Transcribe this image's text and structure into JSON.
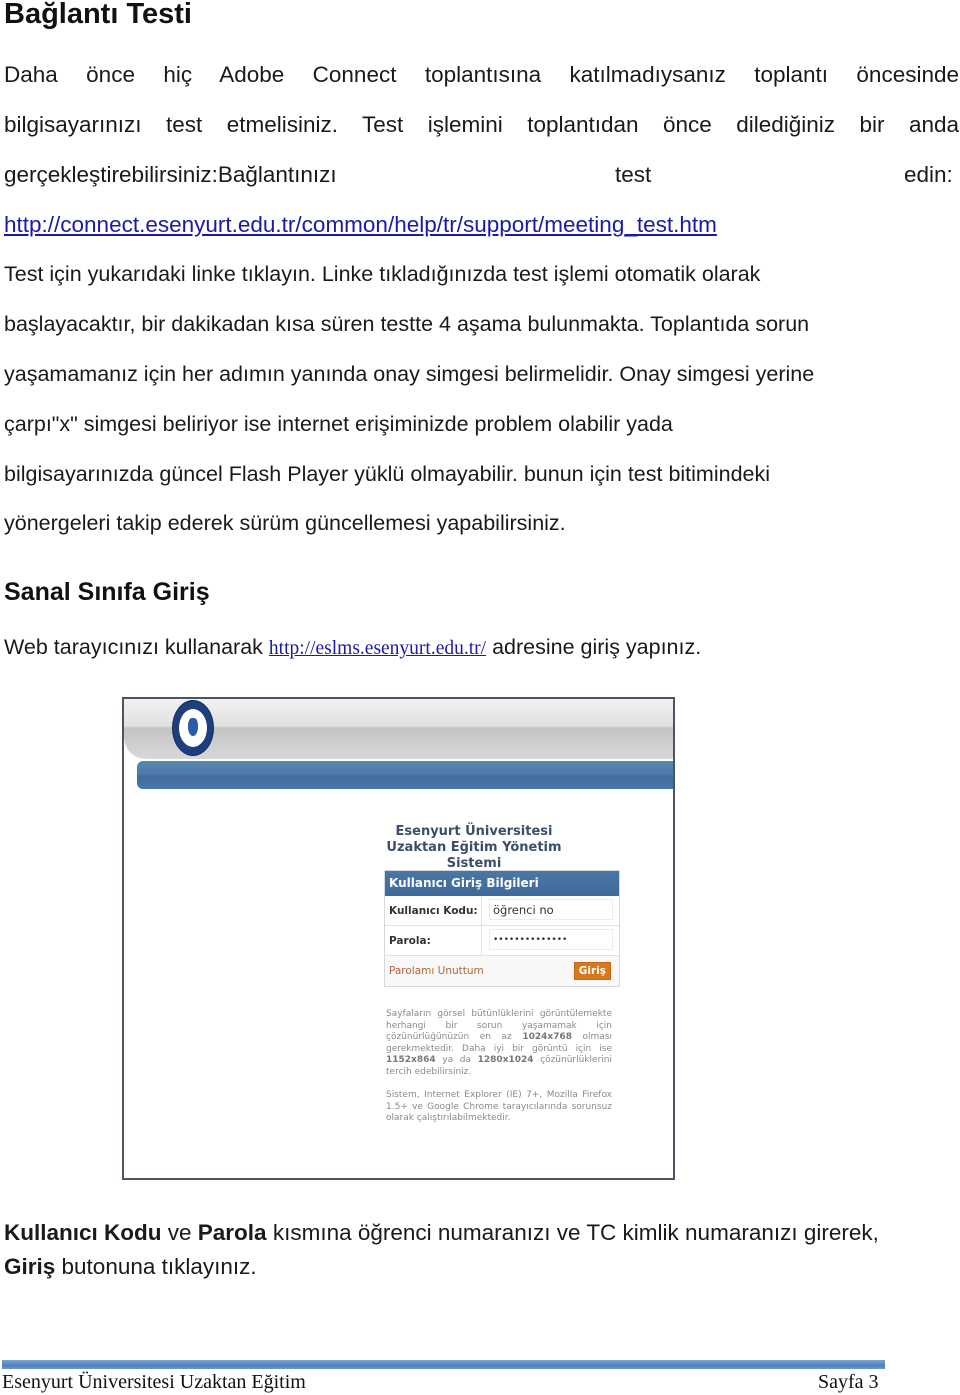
{
  "section1": {
    "title": "Bağlantı Testi",
    "para_lines": [
      "Daha önce hiç Adobe Connect toplantısına katılmadıysanız toplantı öncesinde",
      "bilgisayarınızı test etmelisiniz. Test işlemini toplantıdan önce dilediğiniz bir anda",
      "gerçekleştirebilirsiniz:Bağlantınızı test edin:"
    ],
    "line3_parts": [
      "gerçekleştirebilirsiniz:Bağlantınızı",
      "test",
      "edin:"
    ],
    "test_link": "http://connect.esenyurt.edu.tr/common/help/tr/support/meeting_test.htm",
    "body_lines": [
      "Test için yukarıdaki linke tıklayın. Linke tıkladığınızda test işlemi otomatik olarak",
      "başlayacaktır,  bir dakikadan kısa süren testte 4 aşama bulunmakta. Toplantıda sorun",
      "yaşamamanız için her adımın yanında onay simgesi belirmelidir. Onay simgesi yerine",
      "çarpı\"x\" simgesi beliriyor ise internet erişiminizde problem olabilir yada",
      "bilgisayarınızda güncel Flash Player yüklü olmayabilir. bunun için test bitimindeki",
      "yönergeleri takip ederek sürüm  güncellemesi yapabilirsiniz."
    ]
  },
  "section2": {
    "title": "Sanal Sınıfa Giriş",
    "intro_prefix": "Web tarayıcınızı kullanarak",
    "intro_link": "http://eslms.esenyurt.edu.tr/",
    "intro_suffix": "adresine giriş yapınız."
  },
  "screenshot": {
    "system_title_line1": "Esenyurt Üniversitesi",
    "system_title_line2": "Uzaktan Eğitim Yönetim Sistemi",
    "login_header": "Kullanıcı Giriş Bilgileri",
    "username_label": "Kullanıcı Kodu:",
    "username_value": "öğrenci no",
    "password_label": "Parola:",
    "password_value": "••••••••••••••",
    "forgot_link": "Parolamı Unuttum",
    "login_button": "Giriş",
    "info_p1_a": "Sayfaların görsel bütünlüklerini görüntülemekte herhangi bir sorun yaşamamak için çözünürlüğünüzün en az",
    "info_res1": "1024x768",
    "info_p1_b": "olması gerekmektedir. Daha iyi bir görüntü için ise",
    "info_res2": "1152x864",
    "info_p1_c": "ya da",
    "info_res3": "1280x1024",
    "info_p1_d": "çözünürlüklerini tercih edebilirsiniz.",
    "info_p2": "Sistem, Internet Explorer (IE) 7+, Mozilla Firefox 1.5+ ve Google Chrome tarayıcılarında sorunsuz olarak çalıştırılabilmektedir."
  },
  "note": {
    "bold1": "Kullanıcı Kodu",
    "text1": " ve ",
    "bold2": "Parola",
    "text2": " kısmına öğrenci numaranızı ve TC kimlik numaranızı girerek,",
    "bold3": "Giriş",
    "text3": " butonuna tıklayınız."
  },
  "footer": {
    "left": "Esenyurt Üniversitesi Uzaktan Eğitim",
    "right": "Sayfa 3"
  },
  "colors": {
    "link": "#1a1aa6",
    "footer_bar": "#4f81bd",
    "login_header": "#4072a3",
    "login_button": "#d8781a"
  }
}
